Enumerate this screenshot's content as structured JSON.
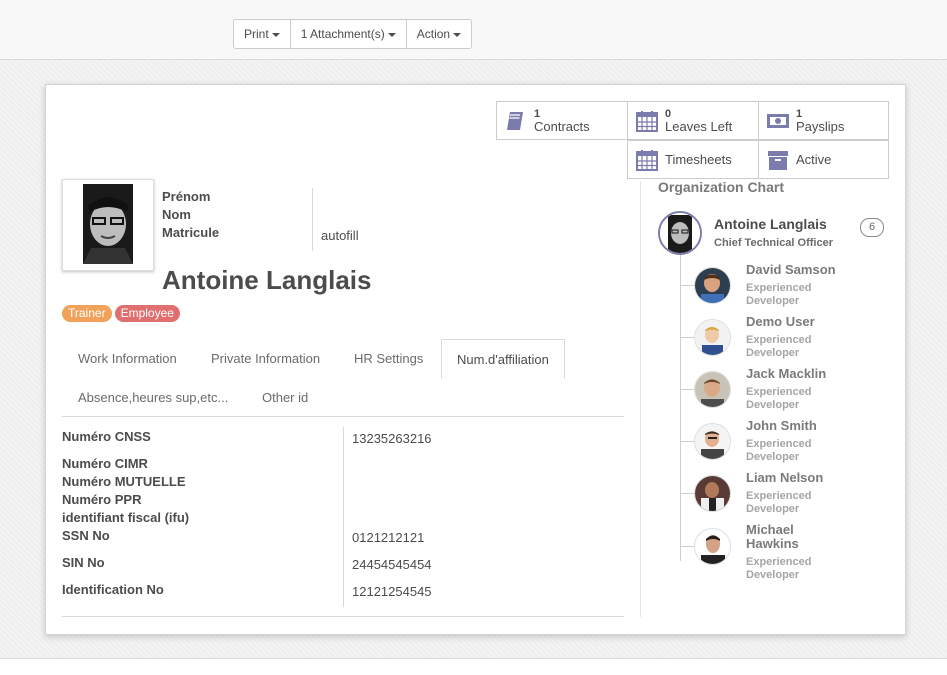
{
  "toolbar": {
    "print_label": "Print",
    "attachments_label": "1 Attachment(s)",
    "action_label": "Action"
  },
  "stats": {
    "contracts": {
      "count": "1",
      "label": "Contracts",
      "icon": "book-icon"
    },
    "leaves": {
      "count": "0",
      "label": "Leaves Left",
      "icon": "calendar-icon"
    },
    "payslips": {
      "count": "1",
      "label": "Payslips",
      "icon": "money-icon"
    },
    "timesheets": {
      "label": "Timesheets",
      "icon": "calendar-icon"
    },
    "active": {
      "label": "Active",
      "icon": "archive-icon"
    }
  },
  "employee": {
    "prenom_label": "Prénom",
    "nom_label": "Nom",
    "matricule_label": "Matricule",
    "matricule_value": "autofill",
    "name": "Antoine Langlais",
    "tags": [
      {
        "label": "Trainer",
        "color": "#f0a15a"
      },
      {
        "label": "Employee",
        "color": "#e06f70"
      }
    ]
  },
  "tabs": [
    {
      "label": "Work Information"
    },
    {
      "label": "Private Information"
    },
    {
      "label": "HR Settings"
    },
    {
      "label": "Num.d'affiliation"
    },
    {
      "label": "Absence,heures sup,etc..."
    },
    {
      "label": "Other id"
    }
  ],
  "active_tab": "Num.d'affiliation",
  "fields": [
    {
      "label": "Numéro CNSS",
      "value": "13235263216"
    },
    {
      "label": "Numéro CIMR",
      "value": ""
    },
    {
      "label": "Numéro MUTUELLE",
      "value": ""
    },
    {
      "label": "Numéro PPR",
      "value": ""
    },
    {
      "label": "identifiant fiscal (ifu)",
      "value": ""
    },
    {
      "label": "SSN No",
      "value": "0121212121"
    },
    {
      "label": "SIN No",
      "value": "24454545454"
    },
    {
      "label": "Identification No",
      "value": "12121254545"
    }
  ],
  "org": {
    "title": "Organization Chart",
    "manager": {
      "name": "Antoine Langlais",
      "job": "Chief Technical Officer",
      "count": "6"
    },
    "subordinates": [
      {
        "name": "David Samson",
        "job": "Experienced Developer"
      },
      {
        "name": "Demo User",
        "job": "Experienced Developer"
      },
      {
        "name": "Jack Macklin",
        "job": "Experienced Developer"
      },
      {
        "name": "John Smith",
        "job": "Experienced Developer"
      },
      {
        "name": "Liam Nelson",
        "job": "Experienced Developer"
      },
      {
        "name": "Michael Hawkins",
        "job": "Experienced Developer"
      }
    ]
  },
  "colors": {
    "accent_icon": "#7c7bad",
    "text": "#4c4c4c"
  }
}
